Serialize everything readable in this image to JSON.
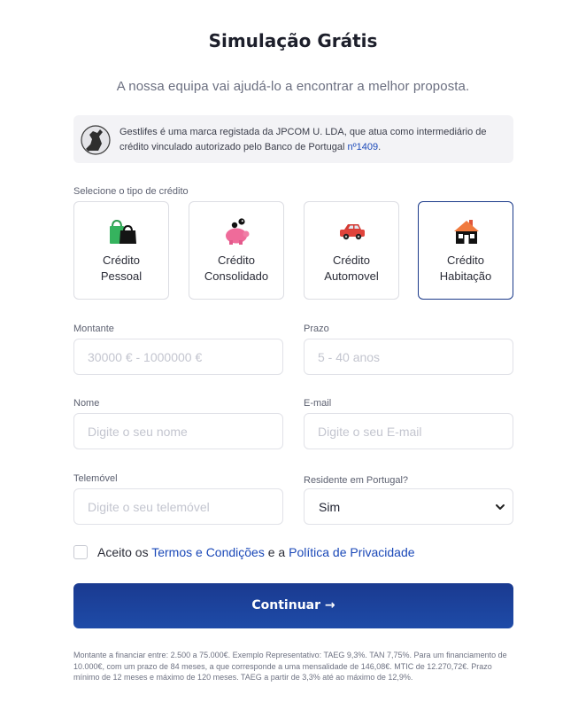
{
  "header": {
    "title": "Simulação Grátis",
    "subtitle": "A nossa equipa vai ajudá-lo a encontrar a melhor proposta."
  },
  "notice": {
    "text": "Gestlifes é uma marca registada da JPCOM U. LDA, que atua como intermediário de crédito vinculado autorizado pelo Banco de Portugal ",
    "registration": "nº1409",
    "end": "."
  },
  "credit_type": {
    "label": "Selecione o tipo de crédito",
    "selected": "Crédito Habitação",
    "options": [
      {
        "line1": "Crédito",
        "line2": "Pessoal",
        "icon": "shopping-bags-icon"
      },
      {
        "line1": "Crédito",
        "line2": "Consolidado",
        "icon": "piggy-bank-icon"
      },
      {
        "line1": "Crédito",
        "line2": "Automovel",
        "icon": "car-icon"
      },
      {
        "line1": "Crédito",
        "line2": "Habitação",
        "icon": "house-icon"
      }
    ]
  },
  "form": {
    "montante": {
      "label": "Montante",
      "placeholder": "30000 € - 1000000 €"
    },
    "prazo": {
      "label": "Prazo",
      "placeholder": "5 - 40 anos"
    },
    "nome": {
      "label": "Nome",
      "placeholder": "Digite o seu nome"
    },
    "email": {
      "label": "E-mail",
      "placeholder": "Digite o seu E-mail"
    },
    "telemovel": {
      "label": "Telemóvel",
      "placeholder": "Digite o seu telemóvel"
    },
    "residente": {
      "label": "Residente em Portugal?",
      "value": "Sim"
    }
  },
  "terms": {
    "prefix": "Aceito os ",
    "terms_link": "Termos e Condições",
    "middle": " e a ",
    "privacy_link": "Política de Privacidade",
    "checked": false
  },
  "submit": {
    "label": "Continuar →"
  },
  "footnote": "Montante a financiar entre: 2.500 a 75.000€. Exemplo Representativo: TAEG 9,3%. TAN 7,75%. Para um financiamento de 10.000€, com um prazo de 84 meses, a que corresponde a uma mensalidade de 146,08€. MTIC de 12.270,72€. Prazo mínimo de 12 meses e máximo de 120 meses. TAEG a partir de 3,3% até ao máximo de 12,9%.",
  "colors": {
    "primary": "#1a3a90",
    "link": "#1a48b8",
    "selected_border": "#1b3a8a"
  }
}
